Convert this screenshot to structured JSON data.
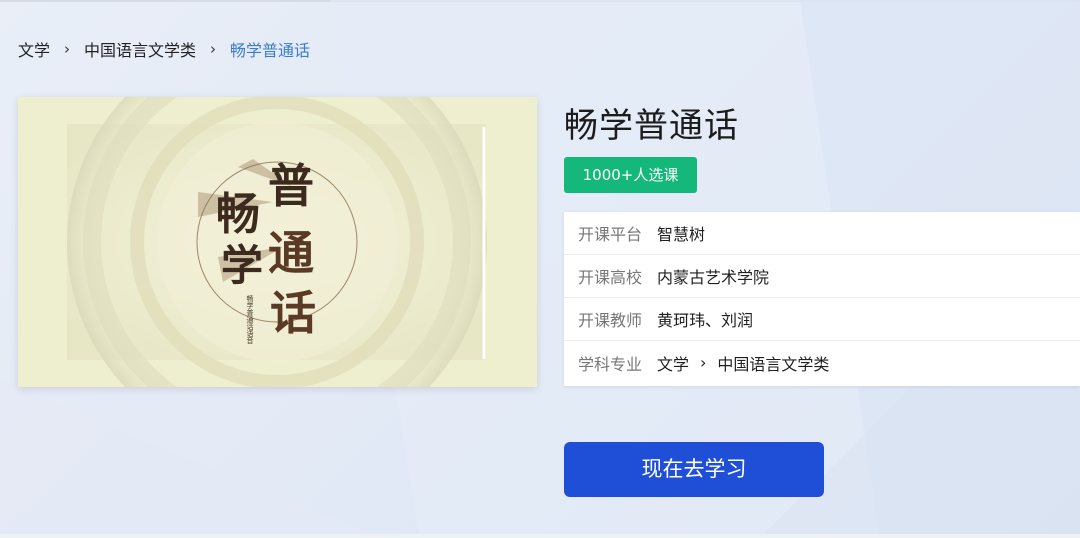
{
  "breadcrumb": {
    "items": [
      "文学",
      "中国语言文学类",
      "畅学普通话"
    ],
    "separator": "›"
  },
  "course": {
    "title": "畅学普通话",
    "enrollment_badge": "1000+人选课",
    "cover": {
      "chars": [
        "普",
        "畅",
        "通",
        "学",
        "话"
      ],
      "small_text": "畅学普通话语音"
    }
  },
  "info": {
    "rows": [
      {
        "label": "开课平台",
        "value": "智慧树"
      },
      {
        "label": "开课高校",
        "value": "内蒙古艺术学院"
      },
      {
        "label": "开课教师",
        "value": "黄珂玮、刘润"
      }
    ],
    "subject": {
      "label": "学科专业",
      "path": [
        "文学",
        "中国语言文学类"
      ]
    }
  },
  "actions": {
    "study_now": "现在去学习"
  },
  "colors": {
    "accent_blue": "#1f4fd6",
    "badge_green": "#14b87a",
    "breadcrumb_active": "#3a7bd5"
  }
}
